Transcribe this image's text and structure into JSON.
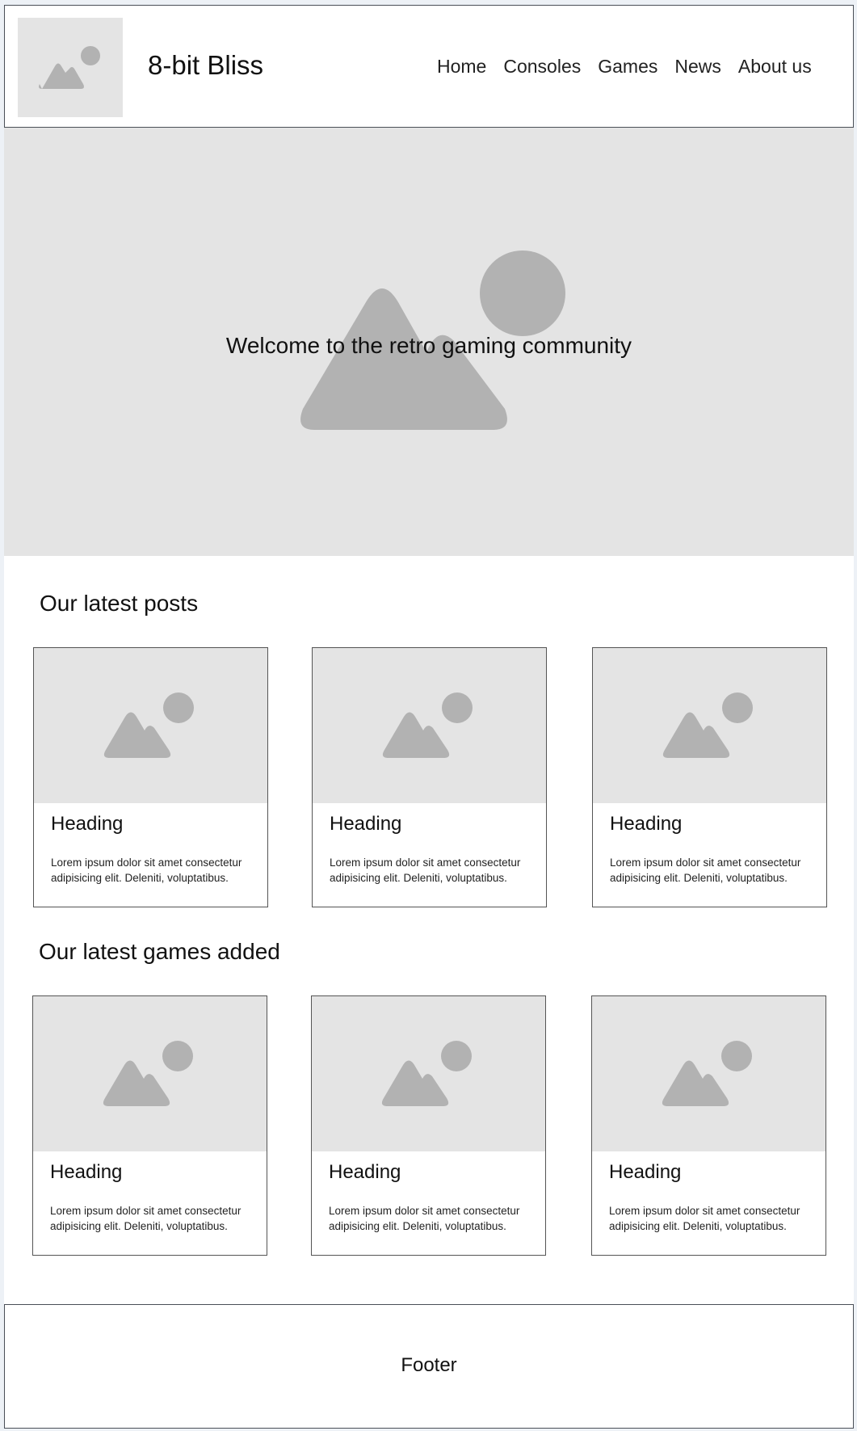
{
  "header": {
    "site_title": "8-bit Bliss",
    "nav": [
      "Home",
      "Consoles",
      "Games",
      "News",
      "About us"
    ]
  },
  "hero": {
    "text": "Welcome to the retro gaming community"
  },
  "posts": {
    "title": "Our latest posts",
    "items": [
      {
        "heading": "Heading",
        "body": "Lorem ipsum dolor sit amet consectetur adipisicing elit. Deleniti, voluptatibus."
      },
      {
        "heading": "Heading",
        "body": "Lorem ipsum dolor sit amet consectetur adipisicing elit. Deleniti, voluptatibus."
      },
      {
        "heading": "Heading",
        "body": "Lorem ipsum dolor sit amet consectetur adipisicing elit. Deleniti, voluptatibus."
      }
    ]
  },
  "games": {
    "title": "Our latest games added",
    "items": [
      {
        "heading": "Heading",
        "body": "Lorem ipsum dolor sit amet consectetur adipisicing elit. Deleniti, voluptatibus."
      },
      {
        "heading": "Heading",
        "body": "Lorem ipsum dolor sit amet consectetur adipisicing elit. Deleniti, voluptatibus."
      },
      {
        "heading": "Heading",
        "body": "Lorem ipsum dolor sit amet consectetur adipisicing elit. Deleniti, voluptatibus."
      }
    ]
  },
  "footer": {
    "text": "Footer"
  },
  "icons": {
    "placeholder": "image-placeholder-icon"
  },
  "colors": {
    "placeholder_bg": "#e4e4e4",
    "placeholder_shape": "#b2b2b2",
    "border": "#4a4f57",
    "outer_bg": "#edf1f6"
  }
}
